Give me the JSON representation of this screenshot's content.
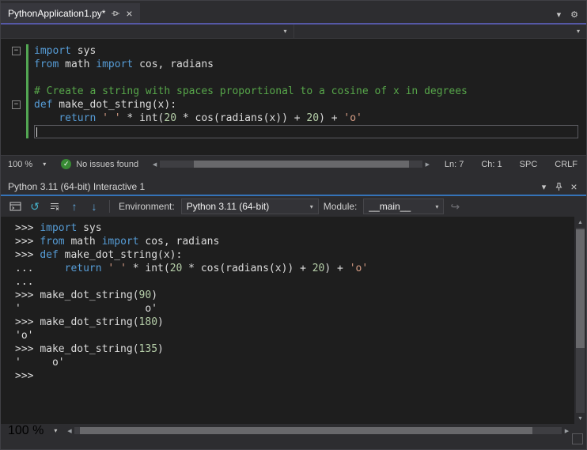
{
  "doc_tab": {
    "title": "PythonApplication1.py*"
  },
  "icons": {
    "close": "×",
    "chevron_down": "▾",
    "gear": "⚙",
    "check": "✓",
    "scroll_left": "◀",
    "scroll_right": "▶",
    "scroll_up": "▲",
    "scroll_down": "▼",
    "reset": "↺",
    "history_previous": "↑",
    "history_next": "↓",
    "redo": "↪",
    "fold_collapse": "−"
  },
  "colors": {
    "keyword": "#569cd6",
    "string": "#d69d85",
    "comment": "#57a64a",
    "number": "#b5cea8",
    "plain_text": "#dcdcdc",
    "editor_background": "#1e1e1e",
    "chrome_background": "#2d2d30",
    "change_bar": "#53a653",
    "issues_check": "#388a34",
    "document_accent": "#5558a6",
    "toolwindow_accent": "#3573b8"
  },
  "editor": {
    "lines": [
      {
        "fold": true,
        "changed": true,
        "tokens": [
          {
            "c": "kw",
            "t": "import"
          },
          {
            "c": "pl",
            "t": " sys"
          }
        ]
      },
      {
        "changed": true,
        "tokens": [
          {
            "c": "kw",
            "t": "from"
          },
          {
            "c": "pl",
            "t": " math "
          },
          {
            "c": "kw",
            "t": "import"
          },
          {
            "c": "pl",
            "t": " cos, radians"
          }
        ]
      },
      {
        "changed": true,
        "tokens": []
      },
      {
        "changed": true,
        "tokens": [
          {
            "c": "com",
            "t": "# Create a string with spaces proportional to a cosine of x in degrees"
          }
        ]
      },
      {
        "fold": true,
        "changed": true,
        "tokens": [
          {
            "c": "kw",
            "t": "def"
          },
          {
            "c": "pl",
            "t": " make_dot_string(x):"
          }
        ]
      },
      {
        "changed": true,
        "tokens": [
          {
            "c": "pl",
            "t": "    "
          },
          {
            "c": "kw",
            "t": "return"
          },
          {
            "c": "pl",
            "t": " "
          },
          {
            "c": "str",
            "t": "' '"
          },
          {
            "c": "pl",
            "t": " * int("
          },
          {
            "c": "num",
            "t": "20"
          },
          {
            "c": "pl",
            "t": " * cos(radians(x)) + "
          },
          {
            "c": "num",
            "t": "20"
          },
          {
            "c": "pl",
            "t": ") + "
          },
          {
            "c": "str",
            "t": "'o'"
          }
        ]
      },
      {
        "changed": true,
        "caret": true,
        "tokens": []
      }
    ]
  },
  "editor_status": {
    "zoom": "100 %",
    "issues": "No issues found",
    "line": "Ln: 7",
    "column": "Ch: 1",
    "spaces": "SPC",
    "line_ending": "CRLF"
  },
  "interactive": {
    "title": "Python 3.11 (64-bit) Interactive 1",
    "toolbar": {
      "environment_label": "Environment:",
      "environment_value": "Python 3.11 (64-bit)",
      "module_label": "Module:",
      "module_value": "__main__"
    },
    "zoom": "100 %",
    "lines": [
      [
        {
          "c": "pr",
          "t": ">>> "
        },
        {
          "c": "kw",
          "t": "import"
        },
        {
          "c": "pl",
          "t": " sys"
        }
      ],
      [
        {
          "c": "pr",
          "t": ">>> "
        },
        {
          "c": "kw",
          "t": "from"
        },
        {
          "c": "pl",
          "t": " math "
        },
        {
          "c": "kw",
          "t": "import"
        },
        {
          "c": "pl",
          "t": " cos, radians"
        }
      ],
      [
        {
          "c": "pr",
          "t": ">>> "
        },
        {
          "c": "kw",
          "t": "def"
        },
        {
          "c": "pl",
          "t": " make_dot_string(x):"
        }
      ],
      [
        {
          "c": "pr",
          "t": "... "
        },
        {
          "c": "pl",
          "t": "    "
        },
        {
          "c": "kw",
          "t": "return"
        },
        {
          "c": "pl",
          "t": " "
        },
        {
          "c": "str",
          "t": "' '"
        },
        {
          "c": "pl",
          "t": " * int("
        },
        {
          "c": "num",
          "t": "20"
        },
        {
          "c": "pl",
          "t": " * cos(radians(x)) + "
        },
        {
          "c": "num",
          "t": "20"
        },
        {
          "c": "pl",
          "t": ") + "
        },
        {
          "c": "str",
          "t": "'o'"
        }
      ],
      [
        {
          "c": "pr",
          "t": "..."
        }
      ],
      [
        {
          "c": "pr",
          "t": ">>> "
        },
        {
          "c": "pl",
          "t": "make_dot_string("
        },
        {
          "c": "num",
          "t": "90"
        },
        {
          "c": "pl",
          "t": ")"
        }
      ],
      [
        {
          "c": "pl",
          "t": "'                    o'"
        }
      ],
      [
        {
          "c": "pr",
          "t": ">>> "
        },
        {
          "c": "pl",
          "t": "make_dot_string("
        },
        {
          "c": "num",
          "t": "180"
        },
        {
          "c": "pl",
          "t": ")"
        }
      ],
      [
        {
          "c": "pl",
          "t": "'o'"
        }
      ],
      [
        {
          "c": "pr",
          "t": ">>> "
        },
        {
          "c": "pl",
          "t": "make_dot_string("
        },
        {
          "c": "num",
          "t": "135"
        },
        {
          "c": "pl",
          "t": ")"
        }
      ],
      [
        {
          "c": "pl",
          "t": "'     o'"
        }
      ],
      [
        {
          "c": "pr",
          "t": ">>>"
        }
      ]
    ]
  }
}
